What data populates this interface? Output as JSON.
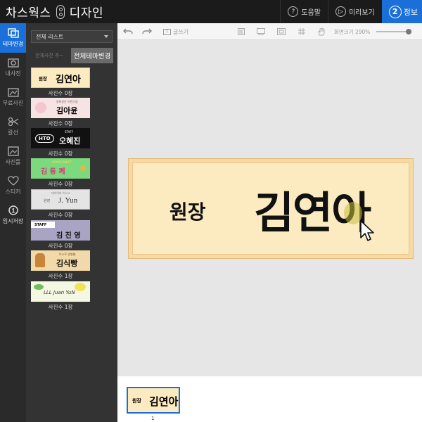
{
  "header": {
    "brand_left": "차스웍스",
    "brand_right": "디자인",
    "help": "도움말",
    "preview": "미리보기",
    "save_num": "②",
    "save_label": "정보"
  },
  "rail": [
    {
      "label": "테마변경",
      "icon": "theme-icon"
    },
    {
      "label": "내사진",
      "icon": "photo-icon"
    },
    {
      "label": "무료사진",
      "icon": "free-photo-icon"
    },
    {
      "label": "칼선",
      "icon": "scissors-icon"
    },
    {
      "label": "사진틀",
      "icon": "frame-icon"
    },
    {
      "label": "스티커",
      "icon": "heart-icon"
    },
    {
      "label": "임시저장",
      "icon": "save-icon",
      "num": "①"
    }
  ],
  "panel": {
    "dropdown": "전체 리스트",
    "sub_tab": "전체사진 추~",
    "all_change": "전체테마변경",
    "themes": [
      {
        "role": "원장",
        "name": "김연아",
        "count": "사진수 0장",
        "bg": "#fcebc1"
      },
      {
        "top": "동화같은 어린이집",
        "name": "김아윤",
        "count": "사진수 0장",
        "bg": "#f6e3e3"
      },
      {
        "brand": "HTO",
        "role": "STAFF",
        "name": "오혜진",
        "count": "사진수 0장",
        "bg": "#111111"
      },
      {
        "top": "HOME SWEET",
        "name": "김 둥 께",
        "count": "사진수 0장",
        "bg": "#7dd97d"
      },
      {
        "top": "데이어바 어시스",
        "role": "원장",
        "name": "J. Yun",
        "count": "사진수 0장",
        "bg": "#e4e4e4"
      },
      {
        "role": "STAFF",
        "name": "김 진 영",
        "count": "사진수 0장",
        "bg": "#a9a3c4"
      },
      {
        "top": "토스트 연봉웹",
        "name": "김식빵",
        "count": "사진수 1장",
        "bg": "#f1d9a9"
      },
      {
        "name": "LLL Juan YuN",
        "count": "사진수 1장",
        "bg": "#f4f7e2"
      }
    ]
  },
  "toolbar": {
    "text_tool": "글쓰기",
    "zoom_label": "화면크기 290%"
  },
  "canvas": {
    "role": "원장",
    "name": "김연아"
  },
  "pages": {
    "thumb_role": "원장",
    "thumb_name": "김연아",
    "page_number": "1"
  }
}
